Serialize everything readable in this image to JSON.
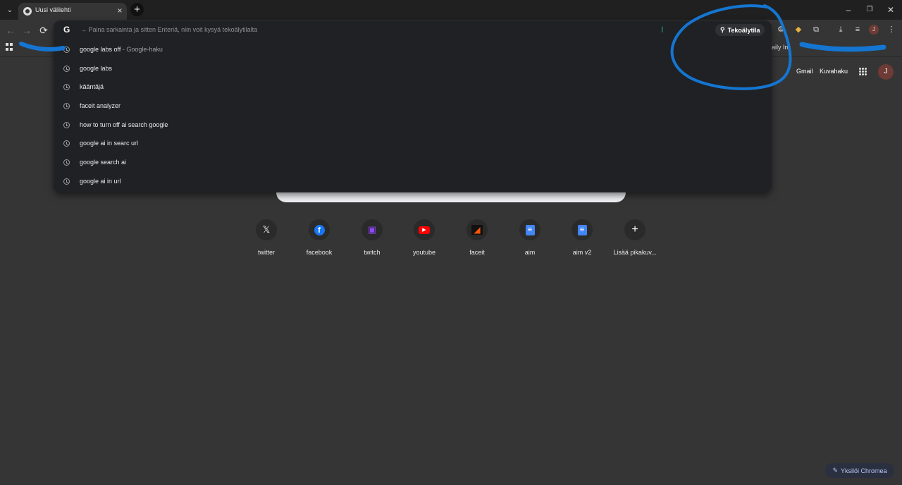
{
  "tab": {
    "title": "Uusi välilehti",
    "close": "×",
    "new": "+"
  },
  "window": {
    "minimize": "–",
    "restore": "❐",
    "close": "✕"
  },
  "toolbar": {
    "back": "←",
    "forward": "→",
    "reload": "⟳",
    "menu": "⋮",
    "profile": "J"
  },
  "bookmarks": {
    "right_text": "aily Im",
    "overflow": "»"
  },
  "omnibox": {
    "logo": "G",
    "hint": "→ Paina sarkainta ja sitten Enteriä, niin voit kysyä tekoälytilalta",
    "cursor": "I",
    "ai_mode_label": "Tekoälytila",
    "suggestions": [
      {
        "text": "google labs off",
        "suffix": " - Google-haku"
      },
      {
        "text": "google labs",
        "suffix": ""
      },
      {
        "text": "kääntäjä",
        "suffix": ""
      },
      {
        "text": "faceit analyzer",
        "suffix": ""
      },
      {
        "text": "how to turn off ai search google",
        "suffix": ""
      },
      {
        "text": "google ai in searc url",
        "suffix": ""
      },
      {
        "text": "google search ai",
        "suffix": ""
      },
      {
        "text": "google ai in url",
        "suffix": ""
      }
    ]
  },
  "google_header": {
    "gmail": "Gmail",
    "images": "Kuvahaku",
    "avatar": "J"
  },
  "shortcuts": [
    {
      "label": "twitter",
      "icon": "x-icon",
      "glyph": "𝕏",
      "color": "#ffffff"
    },
    {
      "label": "facebook",
      "icon": "facebook-icon",
      "glyph": "f",
      "color": "#1877f2"
    },
    {
      "label": "twitch",
      "icon": "twitch-icon",
      "glyph": "▣",
      "color": "#9146ff"
    },
    {
      "label": "youtube",
      "icon": "youtube-icon",
      "glyph": "▶",
      "color": "#ff0000"
    },
    {
      "label": "faceit",
      "icon": "faceit-icon",
      "glyph": "◢",
      "color": "#ff5500"
    },
    {
      "label": "aim",
      "icon": "document-icon",
      "glyph": "≡",
      "color": "#4285f4"
    },
    {
      "label": "aim v2",
      "icon": "document-icon",
      "glyph": "≡",
      "color": "#4285f4"
    },
    {
      "label": "Lisää pikakuv...",
      "icon": "plus-icon",
      "glyph": "+",
      "color": "#ffffff"
    }
  ],
  "customize": {
    "label": "Yksilöi Chromea",
    "icon": "pencil-icon"
  },
  "colors": {
    "annotation_blue": "#1476d2",
    "background": "#353535",
    "omnibox_bg": "#202124"
  }
}
